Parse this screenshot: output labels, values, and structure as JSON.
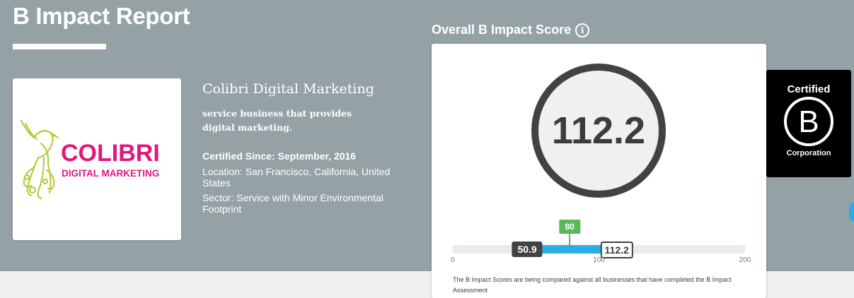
{
  "page": {
    "title": "B Impact Report"
  },
  "company": {
    "logo_text": "COLIBRI",
    "logo_subtext": "DIGITAL MARKETING",
    "name": "Colibri Digital Marketing",
    "description": "service business that provides digital marketing.",
    "certified_since": "Certified Since: September, 2016",
    "location": "Location: San Francisco, California, United States",
    "sector": "Sector: Service with Minor Environmental Footprint"
  },
  "score": {
    "heading": "Overall B Impact Score",
    "info_icon": "info-icon",
    "value": "112.2",
    "median_label": "80",
    "min_label": "50.9",
    "scale_min": 0,
    "scale_max": 200,
    "median": 80,
    "qualify": 50.9,
    "company_score": 112.2,
    "ticks": [
      "0",
      "100",
      "200"
    ],
    "note": "The B Impact Scores are being compared against all businesses that have completed the B Impact Assessment"
  },
  "badge": {
    "top": "Certified",
    "letter": "B",
    "bottom": "Corporation"
  },
  "colors": {
    "hero": "#94a2a6",
    "logo_magenta": "#e0177d",
    "logo_green": "#b4c92a",
    "median_green": "#5cb85c",
    "bar_blue": "#2aaee1",
    "dark": "#424242"
  }
}
